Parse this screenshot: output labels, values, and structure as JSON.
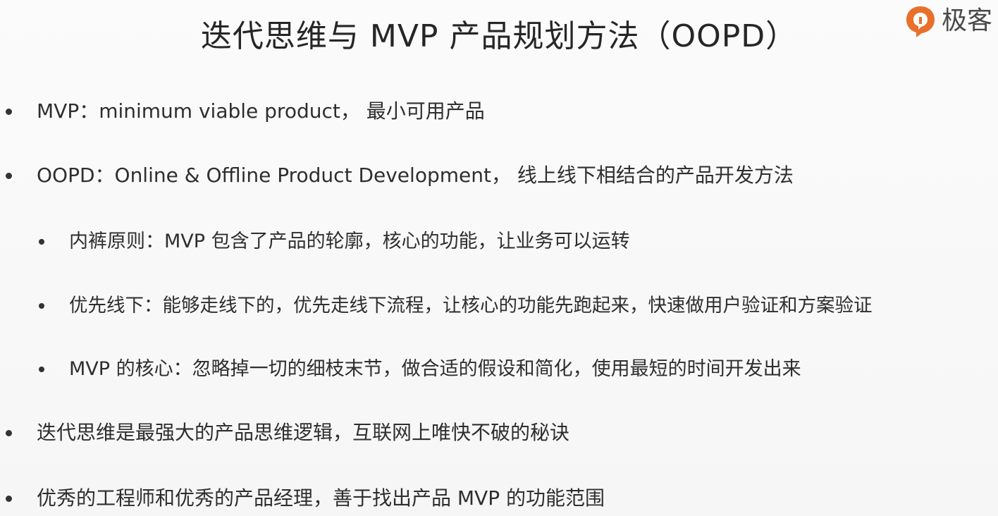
{
  "title": "迭代思维与 MVP 产品规划方法（OOPD）",
  "logo": {
    "text": "极客",
    "icon": "geektime-logo-icon",
    "color": "#e8702a"
  },
  "bullets": [
    "MVP：minimum viable product， 最小可用产品",
    "OOPD：Online & Offline Product Development， 线上线下相结合的产品开发方法",
    "迭代思维是最强大的产品思维逻辑，互联网上唯快不破的秘诀",
    "优秀的工程师和优秀的产品经理，善于找出产品 MVP 的功能范围"
  ],
  "sub_bullets": [
    "内裤原则：MVP 包含了产品的轮廓，核心的功能，让业务可以运转",
    "优先线下：能够走线下的，优先走线下流程，让核心的功能先跑起来，快速做用户验证和方案验证",
    "MVP 的核心：忽略掉一切的细枝末节，做合适的假设和简化，使用最短的时间开发出来"
  ]
}
